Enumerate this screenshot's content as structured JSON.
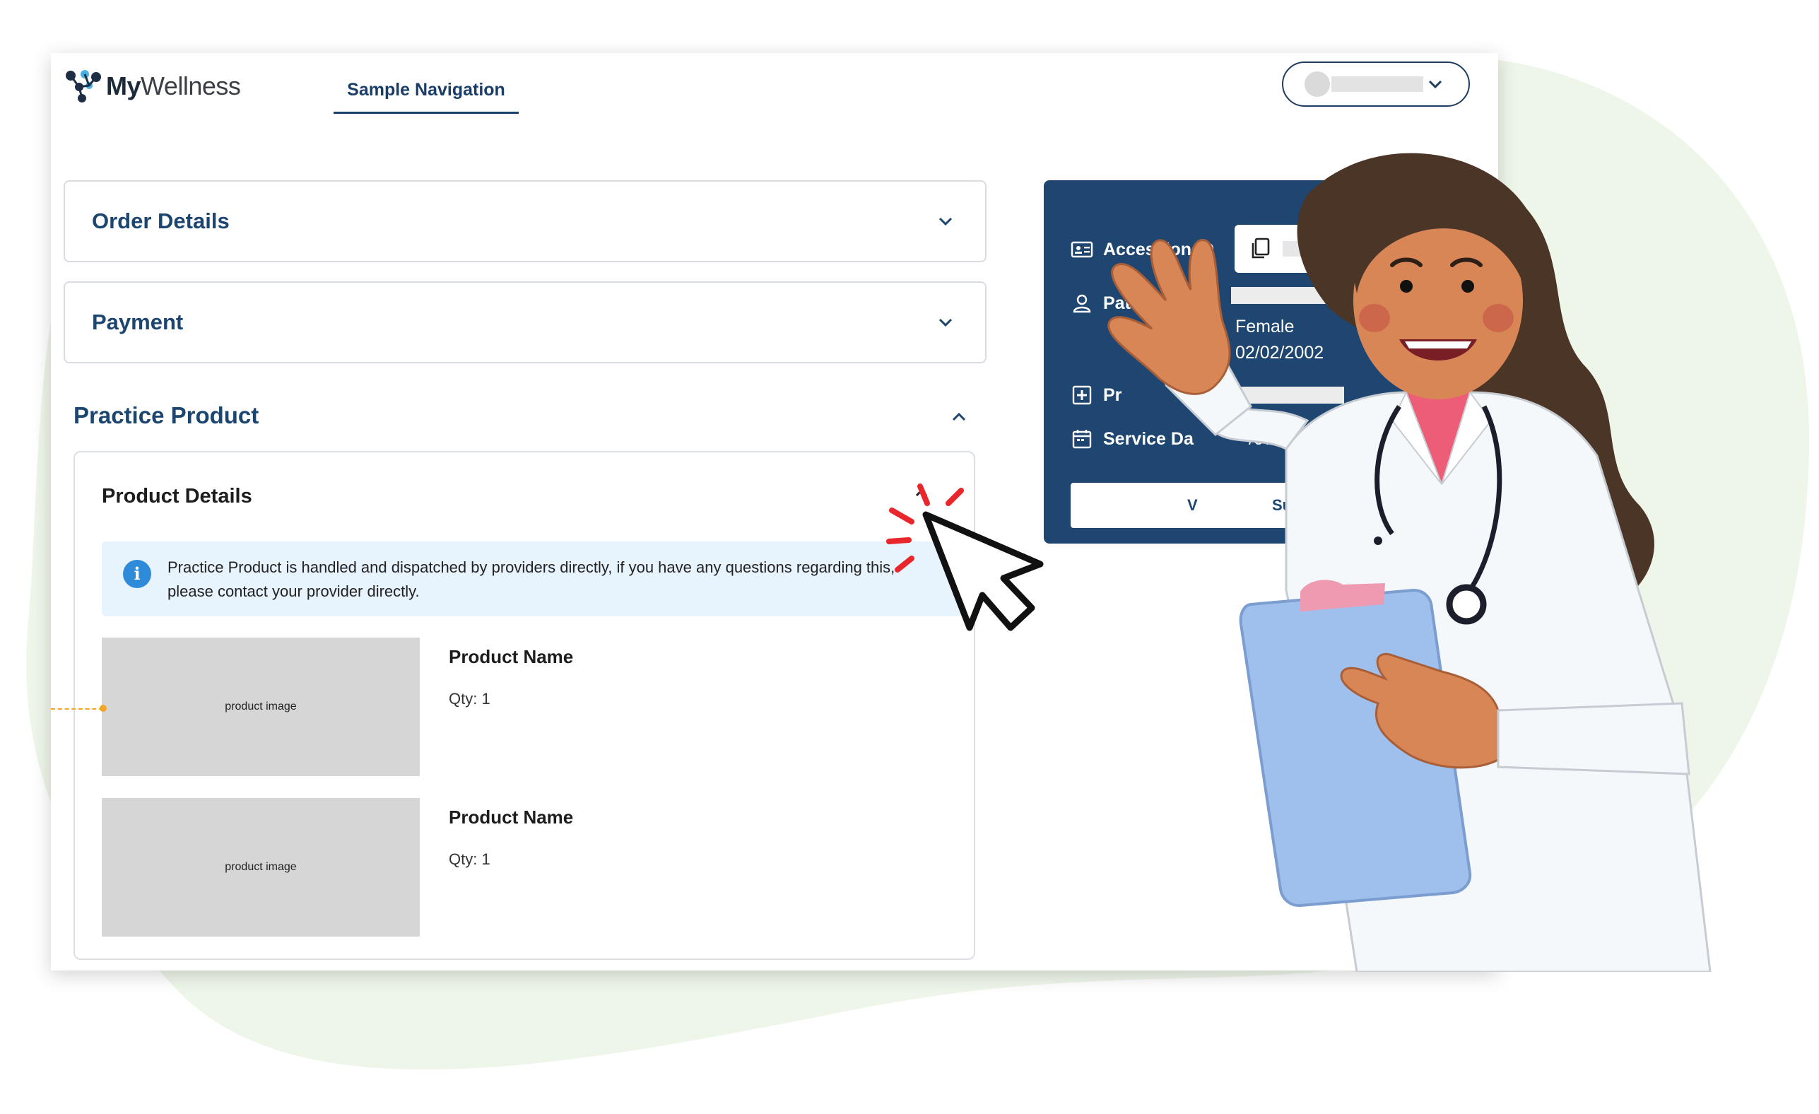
{
  "brand": {
    "logo_prefix": "My",
    "logo_suffix": "Wellness"
  },
  "nav": {
    "tab_label": "Sample Navigation"
  },
  "accordions": [
    {
      "title": "Order Details"
    },
    {
      "title": "Payment"
    }
  ],
  "practice_section": {
    "title": "Practice Product",
    "card_title": "Product Details",
    "info_text": "Practice Product is handled and dispatched by providers directly, if you have any questions regarding this, please contact your provider directly.",
    "products": [
      {
        "image_label": "product image",
        "name": "Product Name",
        "qty": "Qty: 1"
      },
      {
        "image_label": "product image",
        "name": "Product Name",
        "qty": "Qty: 1"
      }
    ]
  },
  "side_panel": {
    "accession_label": "Accession ID",
    "patient_label": "Patient",
    "patient_sex": "Female",
    "patient_dob": "02/02/2002",
    "provider_label": "Pr",
    "service_label": "Service Da",
    "service_date": "/07/2025",
    "button_left": "V",
    "button_right": "Summa"
  },
  "colors": {
    "primary": "#1f4670",
    "accent_text": "#1c4670",
    "info_bg": "#e7f3fd",
    "info_icon": "#2f8bd9",
    "background_blob": "#eef6ea",
    "cursor_spark": "#e8262b"
  },
  "icons": [
    "chevron-down-icon",
    "chevron-up-icon",
    "info-icon",
    "id-card-icon",
    "user-icon",
    "plus-square-icon",
    "calendar-icon",
    "copy-icon",
    "cursor-icon"
  ]
}
